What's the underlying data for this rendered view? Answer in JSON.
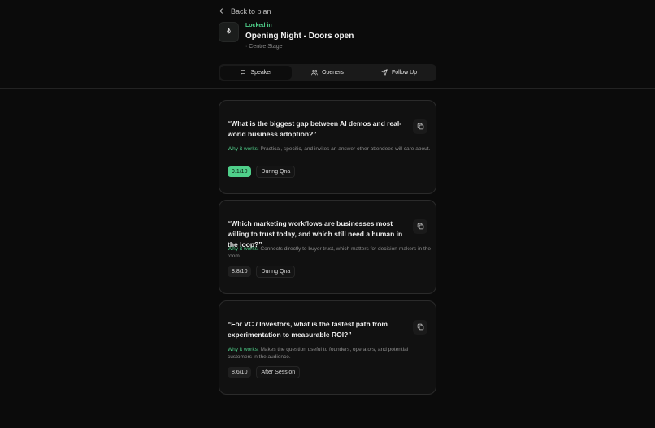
{
  "nav": {
    "back_label": "Back to plan"
  },
  "event": {
    "status": "Locked in",
    "title": "Opening Night - Doors open",
    "venue": "· Centre Stage"
  },
  "tabs": [
    {
      "label": "Speaker",
      "icon": "message-square-icon",
      "active": true
    },
    {
      "label": "Openers",
      "icon": "users-icon",
      "active": false
    },
    {
      "label": "Follow Up",
      "icon": "send-icon",
      "active": false
    }
  ],
  "why_label": "Why it works:",
  "questions": [
    {
      "text": "“What is the biggest gap between AI demos and real-world business adoption?”",
      "why": "Practical, specific, and invites an answer other attendees will care about.",
      "score": "9.1/10",
      "timing": "During Qna",
      "highlight": true
    },
    {
      "text": "“Which marketing workflows are businesses most willing to trust today, and which still need a human in the loop?”",
      "why": "Connects directly to buyer trust, which matters for decision-makers in the room.",
      "score": "8.8/10",
      "timing": "During Qna",
      "highlight": false
    },
    {
      "text": "“For VC / Investors, what is the fastest path from experimentation to measurable ROI?”",
      "why": "Makes the question useful to founders, operators, and potential customers in the audience.",
      "score": "8.6/10",
      "timing": "After Session",
      "highlight": false
    }
  ],
  "colors": {
    "accent": "#4fcf8a",
    "background": "#0b0b0b",
    "card": "#111111"
  }
}
